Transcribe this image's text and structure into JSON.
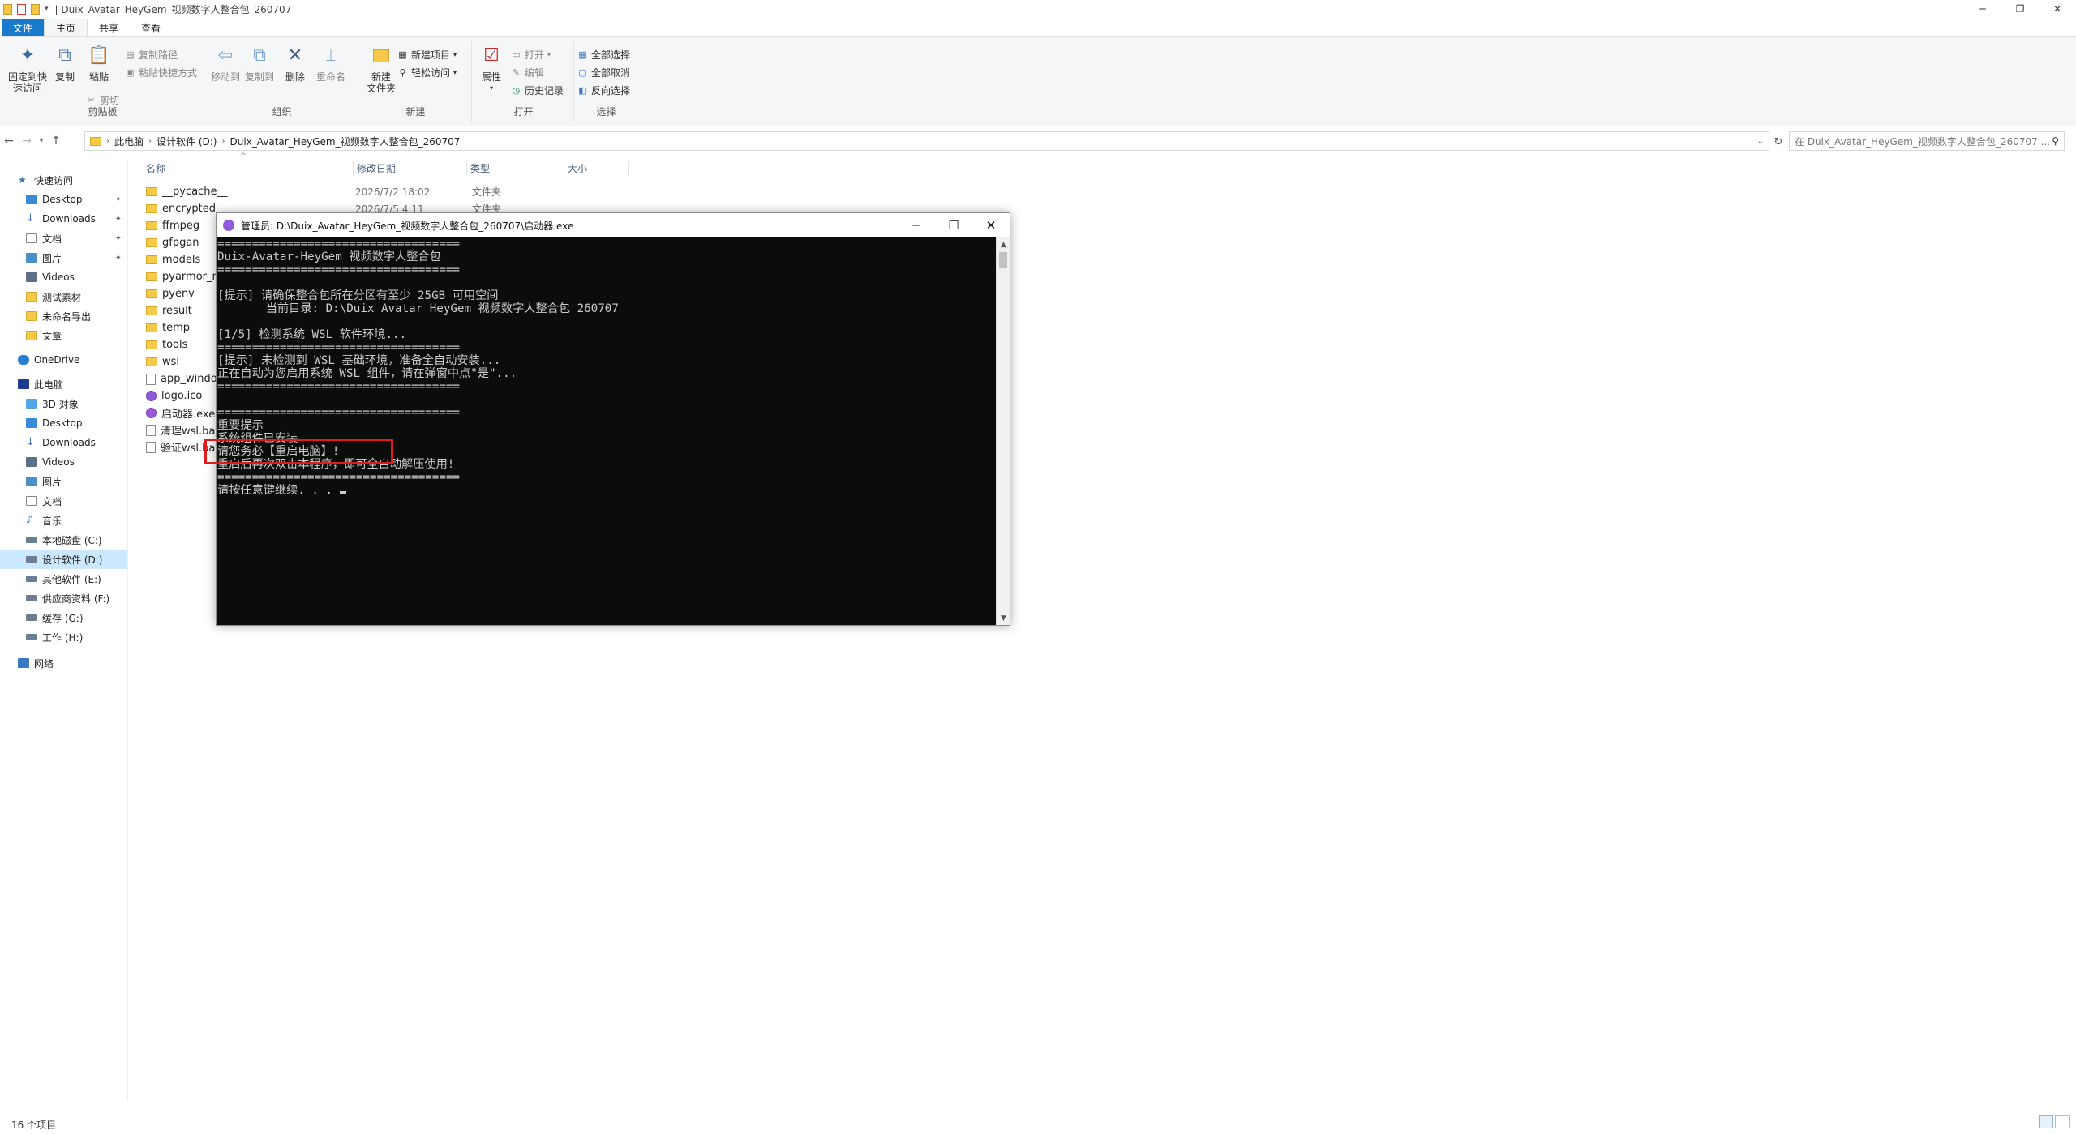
{
  "window": {
    "title": "Duix_Avatar_HeyGem_视频数字人整合包_260707",
    "sep": "|"
  },
  "ribbon_tabs": [
    "文件",
    "主页",
    "共享",
    "查看"
  ],
  "ribbon": {
    "clipboard": {
      "pin_label_1": "固定到快",
      "pin_label_2": "速访问",
      "copy": "复制",
      "paste": "粘贴",
      "copy_path": "复制路径",
      "paste_shortcut": "粘贴快捷方式",
      "cut": "剪切",
      "group": "剪贴板"
    },
    "organize": {
      "move_to": "移动到",
      "copy_to": "复制到",
      "delete": "删除",
      "rename": "重命名",
      "group": "组织"
    },
    "new": {
      "new_folder_1": "新建",
      "new_folder_2": "文件夹",
      "new_item": "新建项目",
      "easy_access": "轻松访问",
      "group": "新建"
    },
    "open": {
      "properties": "属性",
      "open": "打开",
      "edit": "编辑",
      "history": "历史记录",
      "group": "打开"
    },
    "select": {
      "select_all": "全部选择",
      "select_none": "全部取消",
      "invert": "反向选择",
      "group": "选择"
    }
  },
  "address": {
    "crumbs": [
      "此电脑",
      "设计软件 (D:)",
      "Duix_Avatar_HeyGem_视频数字人整合包_260707"
    ],
    "search_placeholder": "在 Duix_Avatar_HeyGem_视频数字人整合包_260707 ..."
  },
  "nav": {
    "quick_access": "快速访问",
    "items": [
      {
        "label": "Desktop",
        "pinned": true
      },
      {
        "label": "Downloads",
        "pinned": true
      },
      {
        "label": "文档",
        "pinned": true
      },
      {
        "label": "图片",
        "pinned": true
      },
      {
        "label": "Videos"
      },
      {
        "label": "测试素材"
      },
      {
        "label": "未命名导出"
      },
      {
        "label": "文章"
      }
    ],
    "onedrive": "OneDrive",
    "this_pc": "此电脑",
    "pc_items": [
      "3D 对象",
      "Desktop",
      "Downloads",
      "Videos",
      "图片",
      "文档",
      "音乐",
      "本地磁盘 (C:)",
      "设计软件 (D:)",
      "其他软件 (E:)",
      "供应商资料 (F:)",
      "缓存 (G:)",
      "工作 (H:)"
    ],
    "network": "网络",
    "pin_glyph": "📌"
  },
  "file_headers": [
    "名称",
    "修改日期",
    "类型",
    "大小"
  ],
  "files": [
    {
      "name": "__pycache__",
      "date": "2026/7/2 18:02",
      "type": "文件夹"
    },
    {
      "name": "encrypted",
      "date": "2026/7/5 4:11",
      "type": "文件夹"
    },
    {
      "name": "ffmpeg"
    },
    {
      "name": "gfpgan"
    },
    {
      "name": "models"
    },
    {
      "name": "pyarmor_ru"
    },
    {
      "name": "pyenv"
    },
    {
      "name": "result"
    },
    {
      "name": "temp"
    },
    {
      "name": "tools"
    },
    {
      "name": "wsl"
    },
    {
      "name": "app_window"
    },
    {
      "name": "logo.ico"
    },
    {
      "name": "启动器.exe"
    },
    {
      "name": "清理wsl.bat"
    },
    {
      "name": "验证wsl.bat"
    }
  ],
  "console": {
    "title": "管理员: D:\\Duix_Avatar_HeyGem_视频数字人整合包_260707\\启动器.exe",
    "lines": [
      "===================================",
      "Duix-Avatar-HeyGem 视频数字人整合包",
      "===================================",
      "",
      "[提示] 请确保整合包所在分区有至少 25GB 可用空间",
      "       当前目录: D:\\Duix_Avatar_HeyGem_视频数字人整合包_260707",
      "",
      "[1/5] 检测系统 WSL 软件环境...",
      "===================================",
      "[提示] 未检测到 WSL 基础环境，准备全自动安装...",
      "正在自动为您启用系统 WSL 组件，请在弹窗中点\"是\"...",
      "===================================",
      "",
      "===================================",
      "重要提示",
      "系统组件已安装",
      "请您务必【重启电脑】!",
      "重启后再次双击本程序，即可全自动解压使用!",
      "===================================",
      "请按任意键继续. . . "
    ]
  },
  "status": {
    "count": "16 个项目"
  }
}
